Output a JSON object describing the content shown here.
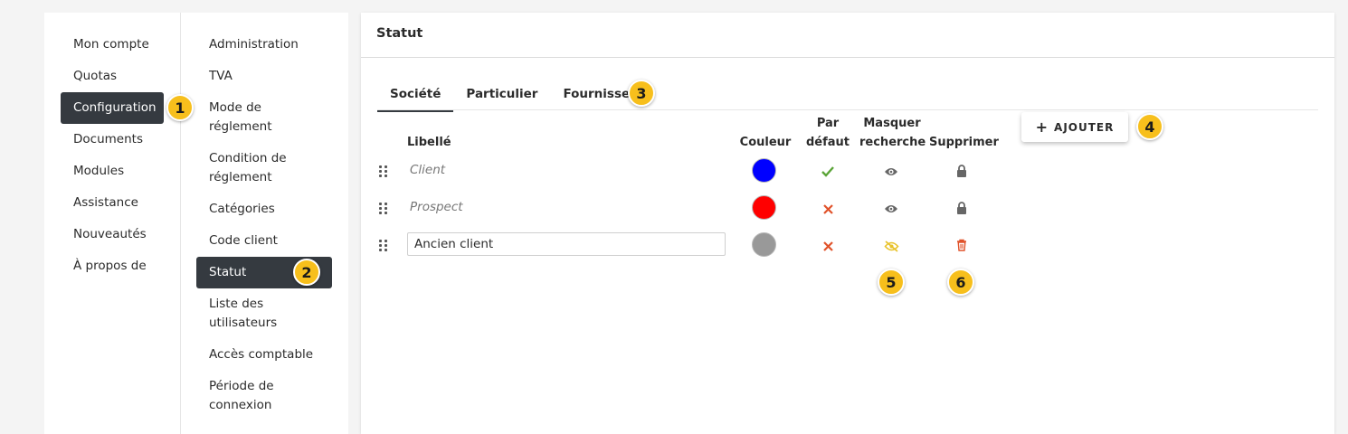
{
  "sidebar": {
    "items": [
      {
        "label": "Mon compte"
      },
      {
        "label": "Quotas"
      },
      {
        "label": "Configuration",
        "active": true
      },
      {
        "label": "Documents"
      },
      {
        "label": "Modules"
      },
      {
        "label": "Assistance"
      },
      {
        "label": "Nouveautés"
      },
      {
        "label": "À propos de"
      }
    ]
  },
  "submenu": {
    "items": [
      {
        "label": "Administration"
      },
      {
        "label": "TVA"
      },
      {
        "label": "Mode de réglement"
      },
      {
        "label": "Condition de réglement"
      },
      {
        "label": "Catégories"
      },
      {
        "label": "Code client"
      },
      {
        "label": "Statut",
        "active": true
      },
      {
        "label": "Liste des utilisateurs"
      },
      {
        "label": "Accès comptable"
      },
      {
        "label": "Période de connexion"
      }
    ]
  },
  "main": {
    "title": "Statut",
    "tabs": [
      {
        "label": "Société",
        "active": true
      },
      {
        "label": "Particulier"
      },
      {
        "label": "Fournisseur"
      }
    ],
    "table": {
      "headers": {
        "label": "Libellé",
        "color": "Couleur",
        "default": "Par défaut",
        "hide_search": "Masquer recherche",
        "delete": "Supprimer"
      },
      "rows": [
        {
          "label": "Client",
          "color": "#0000ff",
          "default": true,
          "hide_icon": "eye-icon",
          "delete_icon": "lock-icon",
          "editable": false
        },
        {
          "label": "Prospect",
          "color": "#ff0000",
          "default": false,
          "hide_icon": "eye-icon",
          "delete_icon": "lock-icon",
          "editable": false
        },
        {
          "label": "Ancien client",
          "color": "#999999",
          "default": false,
          "hide_icon": "eye-slash-icon",
          "delete_icon": "trash-icon",
          "editable": true
        }
      ]
    },
    "add_button": {
      "icon": "+",
      "label": "AJOUTER"
    }
  },
  "callouts": [
    "1",
    "2",
    "3",
    "4",
    "5",
    "6"
  ],
  "colors": {
    "active_bg": "#353a40",
    "badge": "#f7bf1c",
    "check": "#5aa437",
    "cross": "#e0522a",
    "icon_gray": "#666666",
    "hidden_eye": "#e8c22a",
    "trash": "#e0522a"
  }
}
